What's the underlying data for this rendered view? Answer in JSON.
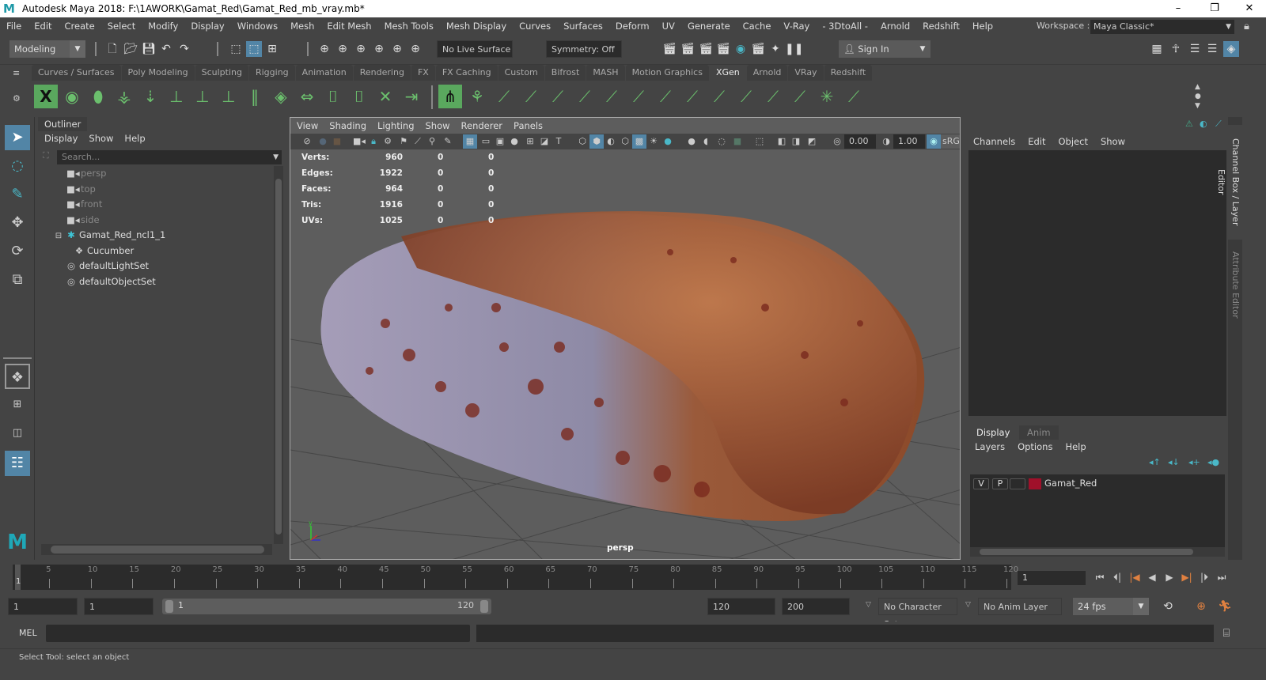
{
  "window": {
    "title": "Autodesk Maya 2018: F:\\1AWORK\\Gamat_Red\\Gamat_Red_mb_vray.mb*",
    "logo": "M",
    "minimize": "–",
    "maximize": "❐",
    "close": "✕"
  },
  "menubar": {
    "items": [
      "File",
      "Edit",
      "Create",
      "Select",
      "Modify",
      "Display",
      "Windows",
      "Mesh",
      "Edit Mesh",
      "Mesh Tools",
      "Mesh Display",
      "Curves",
      "Surfaces",
      "Deform",
      "UV",
      "Generate",
      "Cache",
      "V-Ray",
      "- 3DtoAll -",
      "Arnold",
      "Redshift",
      "Help"
    ],
    "workspace_label": "Workspace :",
    "workspace_value": "Maya Classic*"
  },
  "statusline": {
    "mode": "Modeling",
    "live_surface": "No Live Surface",
    "symmetry": "Symmetry: Off",
    "sign_in": "Sign In"
  },
  "shelf": {
    "tabs": [
      "Curves / Surfaces",
      "Poly Modeling",
      "Sculpting",
      "Rigging",
      "Animation",
      "Rendering",
      "FX",
      "FX Caching",
      "Custom",
      "Bifrost",
      "MASH",
      "Motion Graphics",
      "XGen",
      "Arnold",
      "VRay",
      "Redshift"
    ],
    "active_tab": "XGen"
  },
  "outliner": {
    "title": "Outliner",
    "menu": [
      "Display",
      "Show",
      "Help"
    ],
    "search_placeholder": "Search...",
    "items": [
      {
        "label": "persp",
        "icon": "camera-icon",
        "dim": true
      },
      {
        "label": "top",
        "icon": "camera-icon",
        "dim": true
      },
      {
        "label": "front",
        "icon": "camera-icon",
        "dim": true
      },
      {
        "label": "side",
        "icon": "camera-icon",
        "dim": true
      },
      {
        "label": "Gamat_Red_ncl1_1",
        "icon": "nucleus-icon",
        "dim": false
      },
      {
        "label": "Cucumber",
        "icon": "mesh-icon",
        "dim": false
      },
      {
        "label": "defaultLightSet",
        "icon": "set-icon",
        "dim": false
      },
      {
        "label": "defaultObjectSet",
        "icon": "set-icon",
        "dim": false
      }
    ]
  },
  "viewport": {
    "menu": [
      "View",
      "Shading",
      "Lighting",
      "Show",
      "Renderer",
      "Panels"
    ],
    "exposure": "0.00",
    "gamma": "1.00",
    "color_space": "sRG",
    "camera_label": "persp",
    "hud": [
      {
        "label": "Verts:",
        "v1": "960",
        "v2": "0",
        "v3": "0"
      },
      {
        "label": "Edges:",
        "v1": "1922",
        "v2": "0",
        "v3": "0"
      },
      {
        "label": "Faces:",
        "v1": "964",
        "v2": "0",
        "v3": "0"
      },
      {
        "label": "Tris:",
        "v1": "1916",
        "v2": "0",
        "v3": "0"
      },
      {
        "label": "UVs:",
        "v1": "1025",
        "v2": "0",
        "v3": "0"
      }
    ]
  },
  "channelbox": {
    "menu": [
      "Channels",
      "Edit",
      "Object",
      "Show"
    ]
  },
  "layereditor": {
    "tabs": [
      "Display",
      "Anim"
    ],
    "active_tab": "Display",
    "menu": [
      "Layers",
      "Options",
      "Help"
    ],
    "layer": {
      "v": "V",
      "p": "P",
      "name": "Gamat_Red",
      "color": "#a0102a"
    }
  },
  "sidetabs": [
    "Channel Box / Layer Editor",
    "Attribute Editor"
  ],
  "timeline": {
    "ticks": [
      5,
      10,
      15,
      20,
      25,
      30,
      35,
      40,
      45,
      50,
      55,
      60,
      65,
      70,
      75,
      80,
      85,
      90,
      95,
      100,
      105,
      110,
      115,
      120
    ],
    "start_marker": "1",
    "current_frame": "1"
  },
  "range": {
    "start": "1",
    "playback_start": "1",
    "slider_start": "1",
    "slider_end": "120",
    "playback_end": "120",
    "end": "200",
    "character_set": "No Character Set",
    "anim_layer": "No Anim Layer",
    "fps": "24 fps"
  },
  "cmdline": {
    "label": "MEL"
  },
  "helpline": {
    "text": "Select Tool: select an object"
  }
}
